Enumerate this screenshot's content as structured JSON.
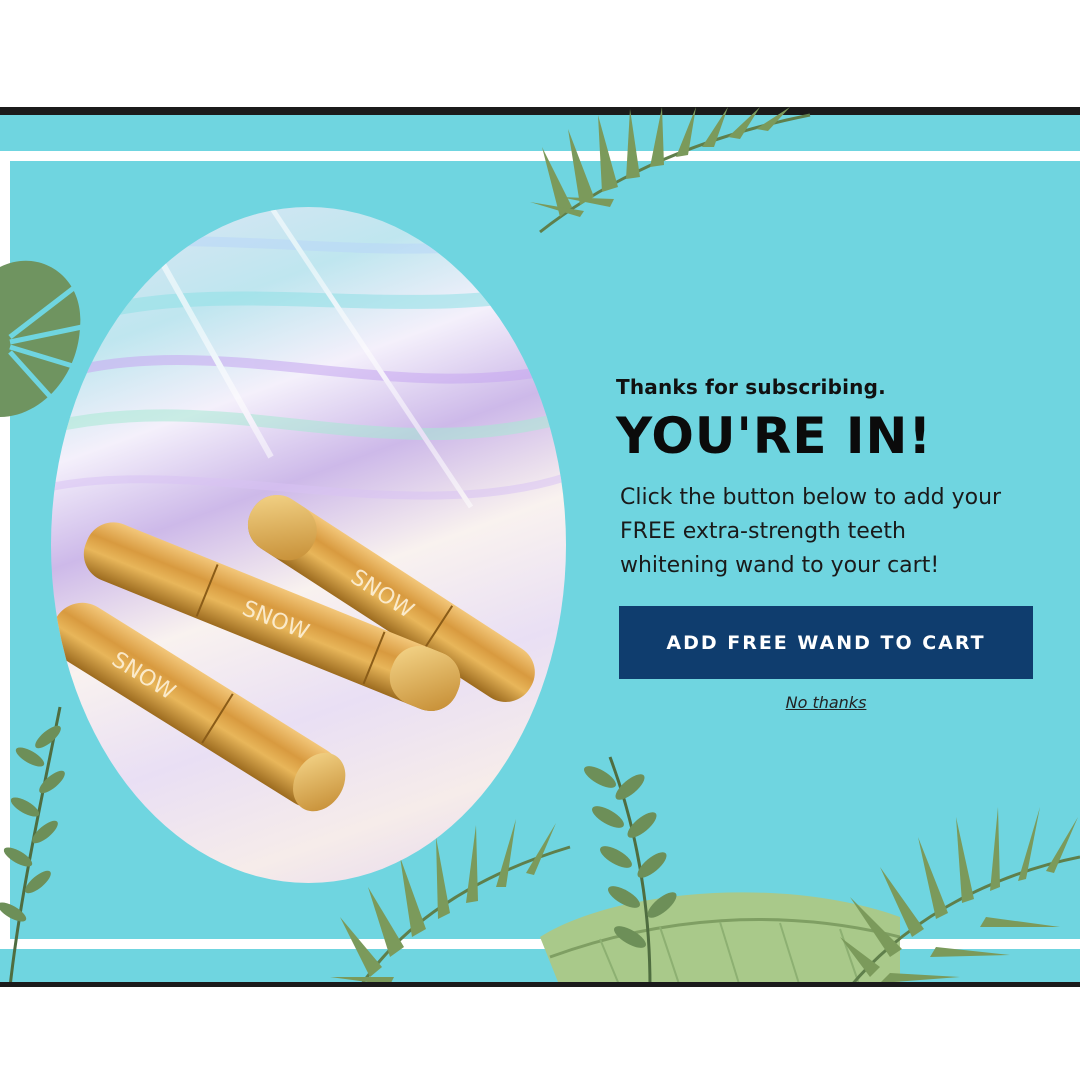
{
  "popup": {
    "subtitle": "Thanks for subscribing.",
    "headline": "YOU'RE IN!",
    "body": "Click the button below to add your FREE extra-strength teeth whitening wand to your cart!",
    "cta_label": "ADD FREE WAND TO CART",
    "decline_label": "No thanks"
  },
  "product_image": {
    "brand_text": "SNOW"
  },
  "colors": {
    "background": "#6fd5e0",
    "cta_background": "#0f3d6e",
    "frame": "#ffffff"
  }
}
